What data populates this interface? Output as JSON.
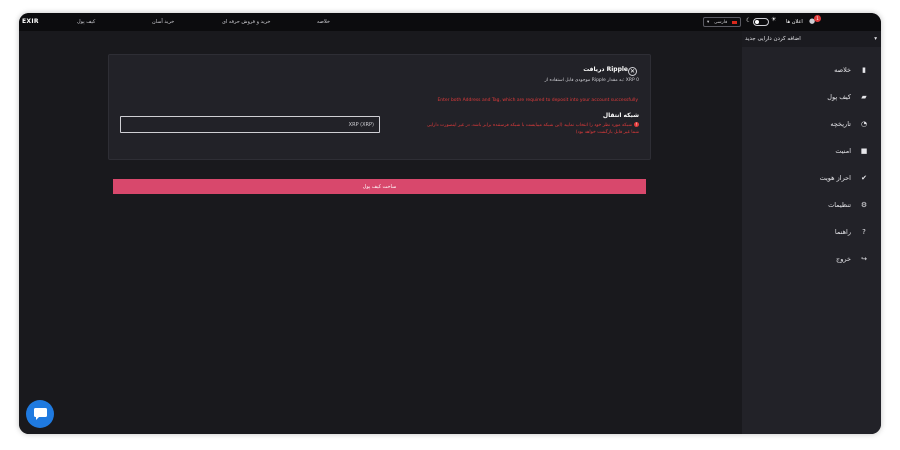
{
  "topbar": {
    "logo": "EXIR",
    "nav": [
      "خلاصه",
      "خرید و فروش حرفه ای",
      "خرید آسان",
      "کیف پول"
    ],
    "language": "فارسی",
    "notifications_label": "اعلان ها",
    "notifications_count": "1"
  },
  "sidebar": {
    "add_asset": "اضافه کردن دارایی جدید",
    "items": [
      {
        "label": "خلاصه",
        "icon": "chart-icon"
      },
      {
        "label": "کیف پول",
        "icon": "wallet-icon"
      },
      {
        "label": "تاریخچه",
        "icon": "history-icon"
      },
      {
        "label": "امنیت",
        "icon": "lock-icon"
      },
      {
        "label": "احراز هویت",
        "icon": "verified-icon"
      },
      {
        "label": "تنظیمات",
        "icon": "gear-icon"
      },
      {
        "label": "راهنما",
        "icon": "help-icon"
      },
      {
        "label": "خروج",
        "icon": "logout-icon"
      }
    ]
  },
  "deposit": {
    "title": "دریافت Ripple",
    "balance": "موجودی قابل استفاده از Ripple به مقدار: XRP 0",
    "error": "Enter both Address and Tag, which are required to deposit into your account successfully",
    "network_label": "شبکه انتقال",
    "network_value": "XRP (XRP)",
    "warning": "شبکه مورد نظر خود را انتخاب نمایید (این شبکه میبایست با شبکه فرستنده برابر باشد، در غیر اینصورت دارایی شما غیر قابل بازگشت خواهد بود)"
  },
  "actions": {
    "create_wallet": "ساخت کیف پول"
  },
  "colors": {
    "accent": "#d8486c",
    "error": "#e23b3b",
    "chat": "#1f7ae0"
  }
}
